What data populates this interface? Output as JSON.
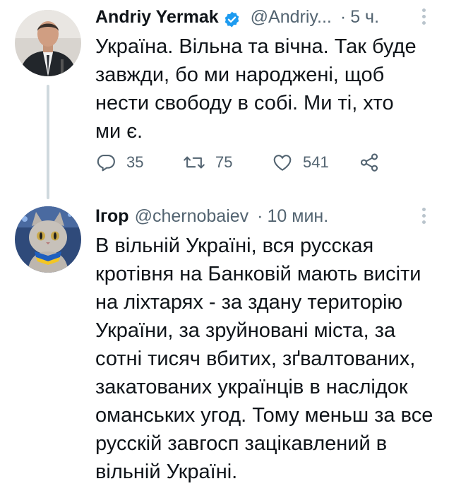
{
  "tweets": [
    {
      "author_name": "Andriy Yermak",
      "verified": true,
      "handle": "@Andriy...",
      "separator": "·",
      "time": "5 ч.",
      "text": "Україна. Вільна та вічна. Так буде завжди, бо ми народжені, щоб нести свободу в собі. Ми ті, хто ми є.",
      "replies": "35",
      "retweets": "75",
      "likes": "541"
    },
    {
      "author_name": "Ігор",
      "verified": false,
      "handle": "@chernobaiev",
      "separator": "·",
      "time": "10 мин.",
      "text": "В вільній Україні, вся русская кротівня на Банковій мають висіти на ліхтарях - за здану територію України, за зруйновані міста, за сотні тисяч вбитих, зґвалтованих, закатованих українців в наслідок оманських угод. Тому меньш за все русскій завгосп зацікавлений в вільній Україні."
    }
  ],
  "icons": {
    "verified": "verified-badge-icon",
    "more": "more-vertical-icon",
    "reply": "reply-icon",
    "retweet": "retweet-icon",
    "like": "heart-icon",
    "share": "share-icon"
  },
  "colors": {
    "text": "#0f1419",
    "secondary": "#536471",
    "verified_blue": "#1d9bf0",
    "thread_line": "#cfd9de"
  }
}
